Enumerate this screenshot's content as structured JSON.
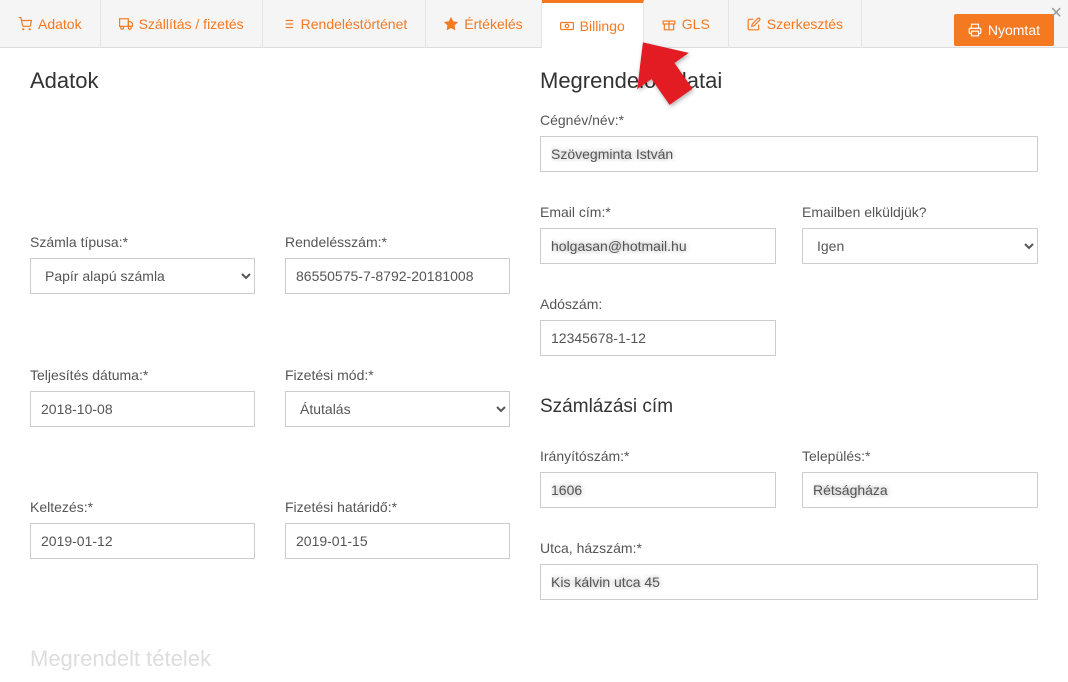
{
  "tabs": [
    {
      "label": "Adatok",
      "icon": "cart"
    },
    {
      "label": "Szállítás / fizetés",
      "icon": "truck"
    },
    {
      "label": "Rendeléstörténet",
      "icon": "list"
    },
    {
      "label": "Értékelés",
      "icon": "star"
    },
    {
      "label": "Billingo",
      "icon": "money"
    },
    {
      "label": "GLS",
      "icon": "gift"
    },
    {
      "label": "Szerkesztés",
      "icon": "edit"
    }
  ],
  "active_tab_index": 4,
  "print_button": "Nyomtat",
  "sections": {
    "adatok_title": "Adatok",
    "megrendelo_title": "Megrendelő adatai",
    "szamlazasi_title": "Számlázási cím",
    "megrendelt_title": "Megrendelt tételek"
  },
  "fields": {
    "szamla_tipusa": {
      "label": "Számla típusa:*",
      "value": "Papír alapú számla"
    },
    "rendelesszam": {
      "label": "Rendelésszám:*",
      "value": "86550575-7-8792-20181008"
    },
    "teljesites": {
      "label": "Teljesítés dátuma:*",
      "value": "2018-10-08"
    },
    "fizetesi_mod": {
      "label": "Fizetési mód:*",
      "value": "Átutalás"
    },
    "keltezes": {
      "label": "Keltezés:*",
      "value": "2019-01-12"
    },
    "fizetesi_hatarido": {
      "label": "Fizetési határidő:*",
      "value": "2019-01-15"
    },
    "cegnev": {
      "label": "Cégnév/név:*",
      "value": "Szövegminta István"
    },
    "email": {
      "label": "Email cím:*",
      "value": "holgasan@hotmail.hu"
    },
    "email_elkuld": {
      "label": "Emailben elküldjük?",
      "value": "Igen"
    },
    "adoszam": {
      "label": "Adószám:",
      "value": "12345678-1-12"
    },
    "iranyitoszam": {
      "label": "Irányítószám:*",
      "value": "1606"
    },
    "telepules": {
      "label": "Település:*",
      "value": "Rétságháza"
    },
    "utca": {
      "label": "Utca, házszám:*",
      "value": "Kis kálvin utca 45"
    }
  }
}
